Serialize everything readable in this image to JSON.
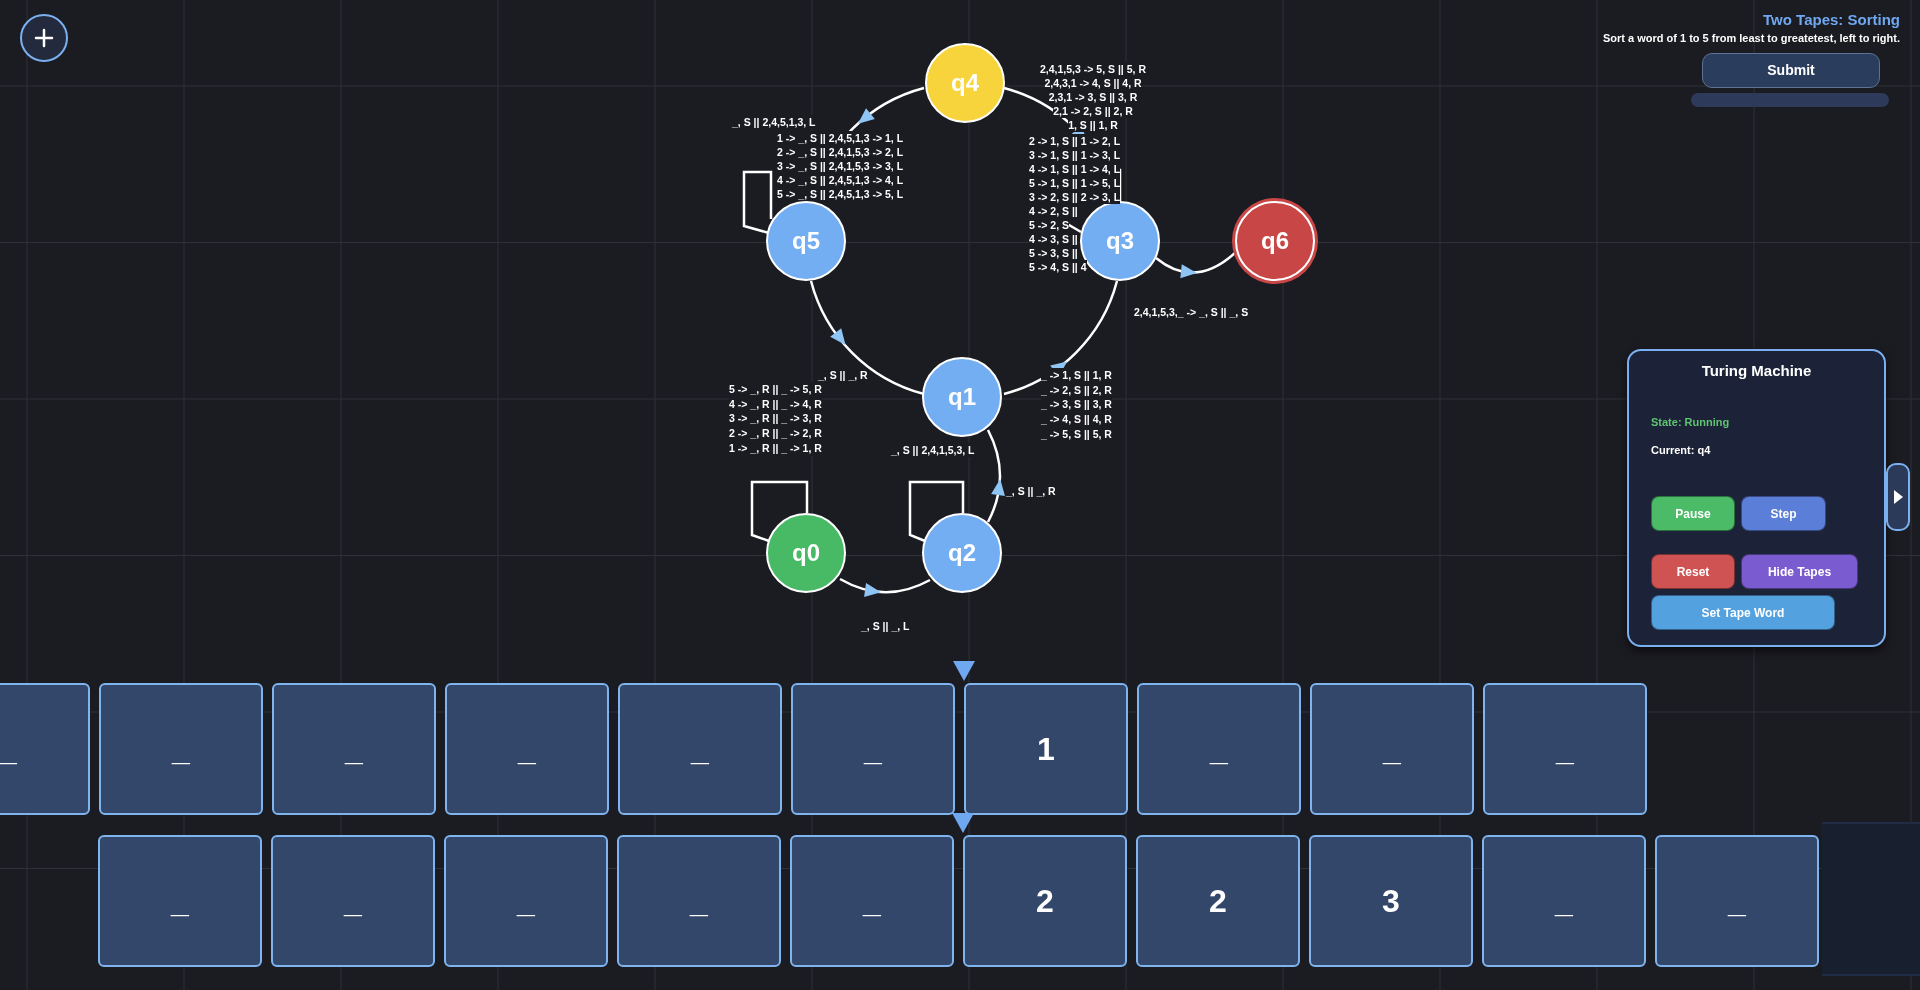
{
  "header": {
    "title": "Two Tapes: Sorting",
    "description": "Sort a word of 1 to 5 from least to greatetest, left to right.",
    "submit": "Submit"
  },
  "diagram": {
    "nodes": [
      {
        "label": "q4",
        "kind": "normal",
        "current": true
      },
      {
        "label": "q5",
        "kind": "normal",
        "current": false
      },
      {
        "label": "q3",
        "kind": "normal",
        "current": false
      },
      {
        "label": "q6",
        "kind": "halt",
        "current": false
      },
      {
        "label": "q1",
        "kind": "normal",
        "current": false
      },
      {
        "label": "q0",
        "kind": "start",
        "current": false
      },
      {
        "label": "q2",
        "kind": "normal",
        "current": false
      }
    ],
    "edges": [
      {
        "labels": [
          "_, S || 2,4,5,1,3, L"
        ]
      },
      {
        "labels": [
          "2,4,1,5,3 -> 5, S || 5, R",
          "2,4,3,1 -> 4, S || 4, R",
          "2,3,1 -> 3, S || 3, R",
          "2,1 -> 2, S || 2, R",
          "1, S || 1, R"
        ]
      },
      {
        "labels": [
          "1 -> _, S || 2,4,5,1,3 -> 1, L",
          "2 -> _, S || 2,4,1,5,3 -> 2, L",
          "3 -> _, S || 2,4,1,5,3 -> 3, L",
          "4 -> _, S || 2,4,5,1,3 -> 4, L",
          "5 -> _, S || 2,4,5,1,3 -> 5, L"
        ]
      },
      {
        "labels": [
          "2 -> 1, S || 1 -> 2, L",
          "3 -> 1, S || 1 -> 3, L",
          "4 -> 1, S || 1 -> 4, L",
          "5 -> 1, S || 1 -> 5, L",
          "3 -> 2, S || 2 -> 3, L",
          "4 -> 2, S ||",
          "5 -> 2, S",
          "4 -> 3, S ||",
          "5 -> 3, S ||",
          "5 -> 4, S || 4"
        ]
      },
      {
        "labels": [
          "2,4,1,5,3,_ -> _, S || _, S"
        ]
      },
      {
        "labels": [
          "_, S || _, R"
        ]
      },
      {
        "labels": [
          "_ -> 1, S || 1, R",
          "_ -> 2, S || 2, R",
          "_ -> 3, S || 3, R",
          "_ -> 4, S || 4, R",
          "_ -> 5, S || 5, R"
        ]
      },
      {
        "labels": [
          "5 -> _, R || _ -> 5, R",
          "4 -> _, R || _ -> 4, R",
          "3 -> _, R || _ -> 3, R",
          "2 -> _, R || _ -> 2, R",
          "1 -> _, R || _ -> 1, R"
        ]
      },
      {
        "labels": [
          "_, S || 2,4,1,5,3, L"
        ]
      },
      {
        "labels": [
          "_, S || _, R"
        ]
      },
      {
        "labels": [
          "_, S || _, L"
        ]
      }
    ]
  },
  "panel": {
    "title": "Turing Machine",
    "state": "State: Running",
    "current": "Current: q4",
    "buttons": [
      {
        "label": "Pause",
        "kind": "pause"
      },
      {
        "label": "Step",
        "kind": "step"
      },
      {
        "label": "Reset",
        "kind": "reset"
      },
      {
        "label": "Hide Tapes",
        "kind": "toggle"
      },
      {
        "label": "Set Tape Word",
        "kind": "set"
      }
    ]
  },
  "tapes": [
    {
      "cells": [
        {
          "symbol": "_",
          "head": false
        },
        {
          "symbol": "_",
          "head": false
        },
        {
          "symbol": "_",
          "head": false
        },
        {
          "symbol": "_",
          "head": false
        },
        {
          "symbol": "_",
          "head": false
        },
        {
          "symbol": "_",
          "head": false
        },
        {
          "symbol": "1",
          "head": true
        },
        {
          "symbol": "_",
          "head": false
        },
        {
          "symbol": "_",
          "head": false
        },
        {
          "symbol": "_",
          "head": false
        }
      ]
    },
    {
      "cells": [
        {
          "symbol": "_",
          "head": false
        },
        {
          "symbol": "_",
          "head": false
        },
        {
          "symbol": "_",
          "head": false
        },
        {
          "symbol": "_",
          "head": false
        },
        {
          "symbol": "_",
          "head": false
        },
        {
          "symbol": "2",
          "head": true
        },
        {
          "symbol": "2",
          "head": false
        },
        {
          "symbol": "3",
          "head": false
        },
        {
          "symbol": "_",
          "head": false
        },
        {
          "symbol": "_",
          "head": false
        }
      ]
    }
  ]
}
